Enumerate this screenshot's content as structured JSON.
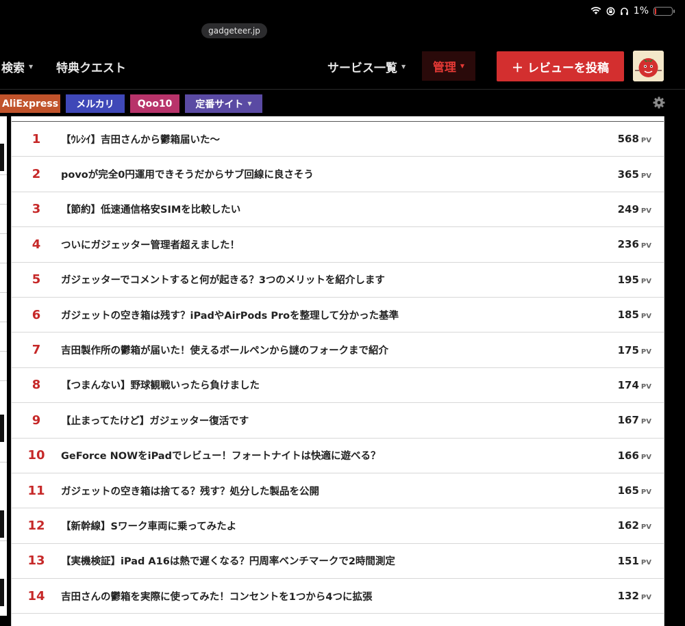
{
  "status_bar": {
    "battery_text": "1%",
    "battery_level": 0.06,
    "battery_color": "#e53935"
  },
  "browser": {
    "url": "gadgeteer.jp"
  },
  "nav": {
    "search_label": "検索",
    "quest_label": "特典クエスト",
    "services_label": "サービス一覧",
    "admin_label": "管理",
    "post_button_label": "＋ レビューを投稿"
  },
  "site_tabs": [
    {
      "label": "AliExpress",
      "color": "#c1532b"
    },
    {
      "label": "メルカリ",
      "color": "#3f48b8"
    },
    {
      "label": "Qoo10",
      "color": "#b8336a"
    },
    {
      "label": "定番サイト",
      "color": "#5a4aa3"
    }
  ],
  "ranking": {
    "pv_unit": "PV",
    "rows": [
      {
        "rank": "1",
        "title": "【ｳﾚｼｲ】吉田さんから鬱箱届いた〜",
        "pv": "568"
      },
      {
        "rank": "2",
        "title": "povoが完全0円運用できそうだからサブ回線に良さそう",
        "pv": "365"
      },
      {
        "rank": "3",
        "title": "【節約】低速通信格安SIMを比較したい",
        "pv": "249"
      },
      {
        "rank": "4",
        "title": "ついにガジェッター管理者超えました！",
        "pv": "236"
      },
      {
        "rank": "5",
        "title": "ガジェッターでコメントすると何が起きる？3つのメリットを紹介します",
        "pv": "195"
      },
      {
        "rank": "6",
        "title": "ガジェットの空き箱は残す？iPadやAirPods Proを整理して分かった基準",
        "pv": "185"
      },
      {
        "rank": "7",
        "title": "吉田製作所の鬱箱が届いた！使えるボールペンから謎のフォークまで紹介",
        "pv": "175"
      },
      {
        "rank": "8",
        "title": "【つまんない】野球観戦いったら負けました",
        "pv": "174"
      },
      {
        "rank": "9",
        "title": "【止まってたけど】ガジェッター復活です",
        "pv": "167"
      },
      {
        "rank": "10",
        "title": "GeForce NOWをiPadでレビュー！フォートナイトは快適に遊べる？",
        "pv": "166"
      },
      {
        "rank": "11",
        "title": "ガジェットの空き箱は捨てる？残す？処分した製品を公開",
        "pv": "165"
      },
      {
        "rank": "12",
        "title": "【新幹線】Sワーク車両に乗ってみたよ",
        "pv": "162"
      },
      {
        "rank": "13",
        "title": "【実機検証】iPad A16は熱で遅くなる？円周率ベンチマークで2時間測定",
        "pv": "151"
      },
      {
        "rank": "14",
        "title": "吉田さんの鬱箱を実際に使ってみた！コンセントを1つから4つに拡張",
        "pv": "132"
      }
    ]
  }
}
